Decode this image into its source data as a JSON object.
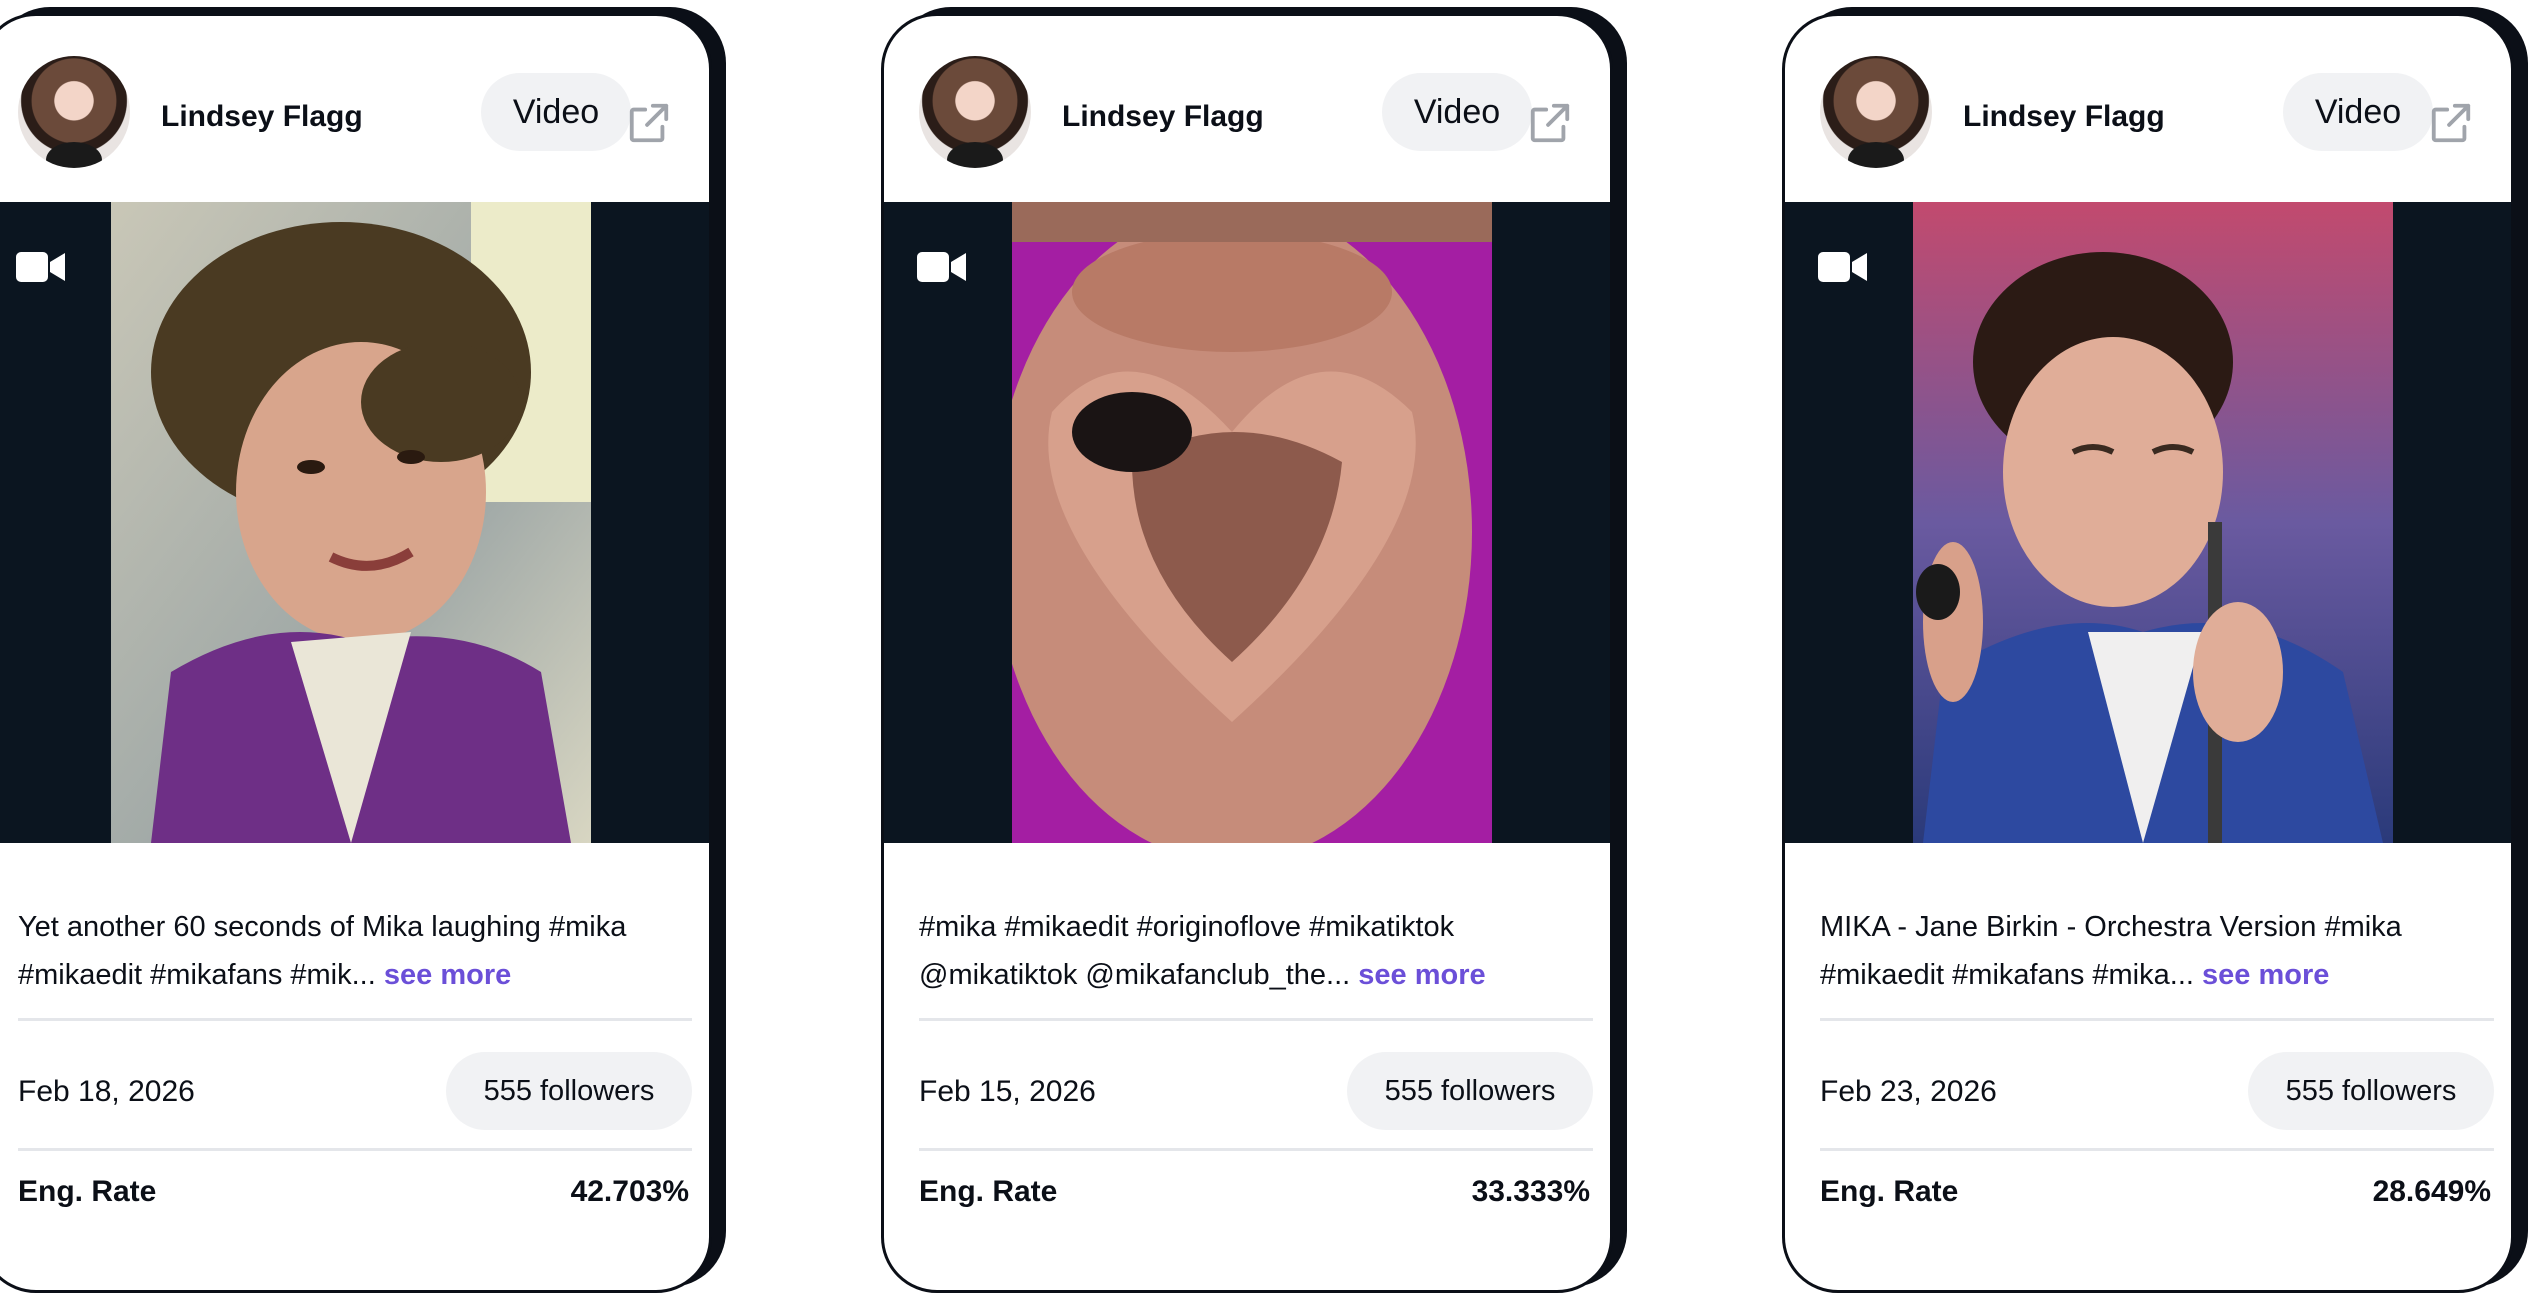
{
  "cards": [
    {
      "author": "Lindsey Flagg",
      "type_label": "Video",
      "caption": "Yet another 60 seconds of Mika laughing #mika #mikaedit #mikafans #mik...",
      "see_more": "see more",
      "date": "Feb 18, 2026",
      "followers": "555 followers",
      "eng_label": "Eng. Rate",
      "eng_value": "42.703%"
    },
    {
      "author": "Lindsey Flagg",
      "type_label": "Video",
      "caption": "#mika #mikaedit #originoflove #mikatiktok @mikatiktok @mikafanclub_the...",
      "see_more": "see more",
      "date": "Feb 15, 2026",
      "followers": "555 followers",
      "eng_label": "Eng. Rate",
      "eng_value": "33.333%"
    },
    {
      "author": "Lindsey Flagg",
      "type_label": "Video",
      "caption": "MIKA - Jane Birkin - Orchestra Version #mika #mikaedit #mikafans #mika...",
      "see_more": "see more",
      "date": "Feb 23, 2026",
      "followers": "555 followers",
      "eng_label": "Eng. Rate",
      "eng_value": "28.649%"
    }
  ],
  "colors": {
    "accent_link": "#6b4fd8",
    "media_bg": "#0b1520",
    "pill_bg": "#f1f2f4",
    "card_border": "#0b0f17"
  },
  "icons": [
    "external-link-icon",
    "video-camera-icon"
  ]
}
